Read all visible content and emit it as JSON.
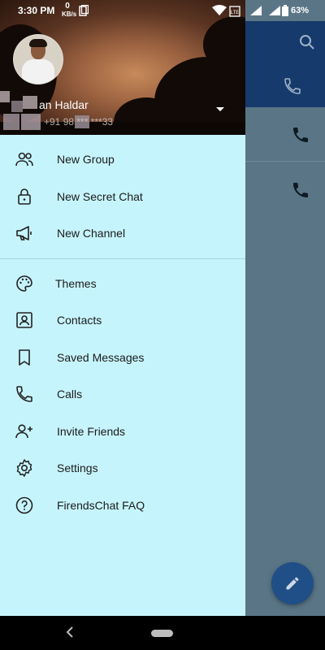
{
  "status_bar": {
    "time": "3:30 PM",
    "net_speed_value": "0",
    "net_speed_unit": "KB/s",
    "battery": "63%"
  },
  "drawer": {
    "user_name": "an Haldar",
    "user_phone": "+91 98 *** ***33",
    "menu": [
      {
        "label": "New Group",
        "icon": "group-icon"
      },
      {
        "label": "New Secret Chat",
        "icon": "lock-icon"
      },
      {
        "label": "New Channel",
        "icon": "megaphone-icon"
      },
      {
        "label": "Themes",
        "icon": "palette-icon"
      },
      {
        "label": "Contacts",
        "icon": "contact-icon"
      },
      {
        "label": "Saved Messages",
        "icon": "bookmark-icon"
      },
      {
        "label": "Calls",
        "icon": "phone-icon"
      },
      {
        "label": "Invite Friends",
        "icon": "add-user-icon"
      },
      {
        "label": "Settings",
        "icon": "settings-icon"
      },
      {
        "label": "FirendsChat FAQ",
        "icon": "help-icon"
      }
    ]
  },
  "colors": {
    "drawer_bg": "#c6f4fc",
    "header_bar": "#163a6b",
    "fab": "#1f4f86"
  }
}
